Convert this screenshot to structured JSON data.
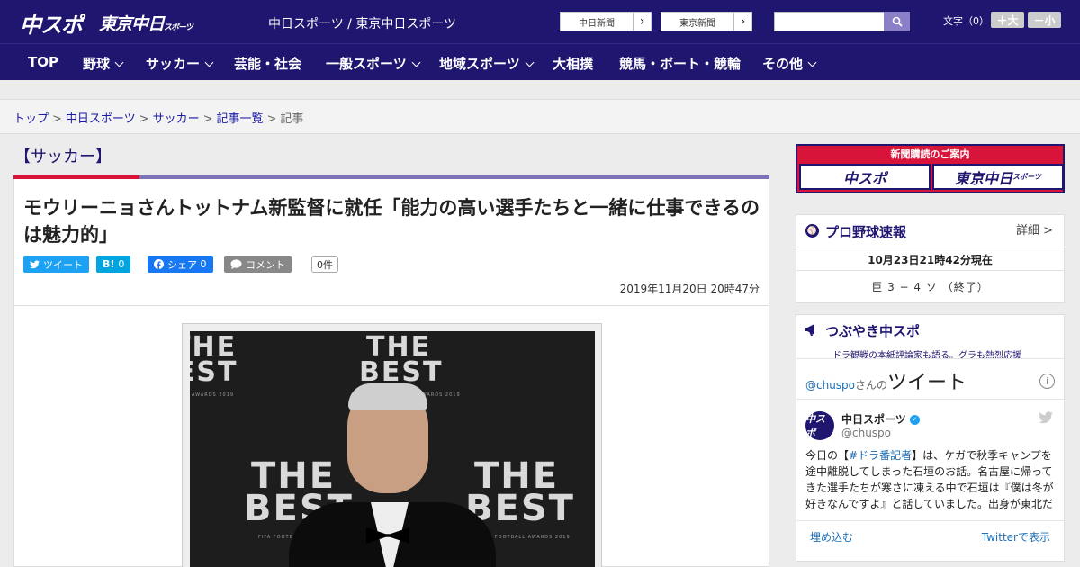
{
  "header": {
    "logo_chuspo": "中スポ",
    "logo_tokyo": "東京中日",
    "logo_tokyo_small": "スポーツ",
    "site_name": "中日スポーツ / 東京中日スポーツ",
    "paper_buttons": [
      "中日新聞",
      "東京新聞"
    ],
    "font_label": "文字（0）",
    "font_larger": "＋大",
    "font_smaller": "－小"
  },
  "nav": {
    "items": [
      {
        "label": "TOP",
        "dropdown": false
      },
      {
        "label": "野球",
        "dropdown": true
      },
      {
        "label": "サッカー",
        "dropdown": true
      },
      {
        "label": "芸能・社会",
        "dropdown": false
      },
      {
        "label": "一般スポーツ",
        "dropdown": true
      },
      {
        "label": "地域スポーツ",
        "dropdown": true
      },
      {
        "label": "大相撲",
        "dropdown": false
      },
      {
        "label": "競馬・ボート・競輪",
        "dropdown": false
      },
      {
        "label": "その他",
        "dropdown": true
      }
    ]
  },
  "breadcrumb": {
    "links": [
      "トップ",
      "中日スポーツ",
      "サッカー",
      "記事一覧"
    ],
    "current": "記事",
    "separator": ">"
  },
  "article": {
    "category": "【サッカー】",
    "title": "モウリーニョさんトットナム新監督に就任「能力の高い選手たちと一緒に仕事できるのは魅力的」",
    "share": {
      "tweet": "ツイート",
      "hatena_icon": "B!",
      "hatena_count": "0",
      "facebook_label": "シェア",
      "facebook_count": "0",
      "comment": "コメント",
      "comment_count": "0件"
    },
    "timestamp": "2019年11月20日 20時47分",
    "photo_text": {
      "the": "THE",
      "best": "BEST",
      "awards": "FIFA FOOTBALL AWARDS 2019",
      "awards_short": "AWARDS 2019"
    }
  },
  "sidebar": {
    "subscription": {
      "title": "新聞購読のご案内",
      "logo_chuspo": "中スポ",
      "logo_tokyo": "東京中日",
      "logo_tokyo_small": "スポーツ"
    },
    "baseball": {
      "icon": "⚾",
      "title": "プロ野球速報",
      "detail": "詳細 >",
      "time": "10月23日21時42分現在",
      "score": "巨 3 − 4 ソ （終了）"
    },
    "tweets": {
      "title": "つぶやき中スポ",
      "subtitle": "ドラ観戦の本紙評論家も語る。グラも熱烈応援",
      "handle_link": "@chuspo",
      "handle_suffix": "さんの",
      "heading": "ツイート",
      "author_name": "中日スポーツ",
      "author_handle": "@chuspo",
      "tweet_prefix": "今日の【",
      "tweet_tag": "#ドラ番記者",
      "tweet_body": "】は、ケガで秋季キャンプを途中離脱してしまった石垣のお話。名古屋に帰ってきた選手たちが寒さに凍える中で石垣は『僕は冬が好きなんですよ』と話していました。出身が東北だ",
      "embed": "埋め込む",
      "view_on_twitter": "Twitterで表示"
    }
  },
  "colors": {
    "brand_navy": "#1f1670",
    "accent_red": "#d8143a",
    "twitter": "#1da1f2",
    "hatena": "#00a4de",
    "facebook": "#1877f2",
    "comment_gray": "#888888"
  }
}
